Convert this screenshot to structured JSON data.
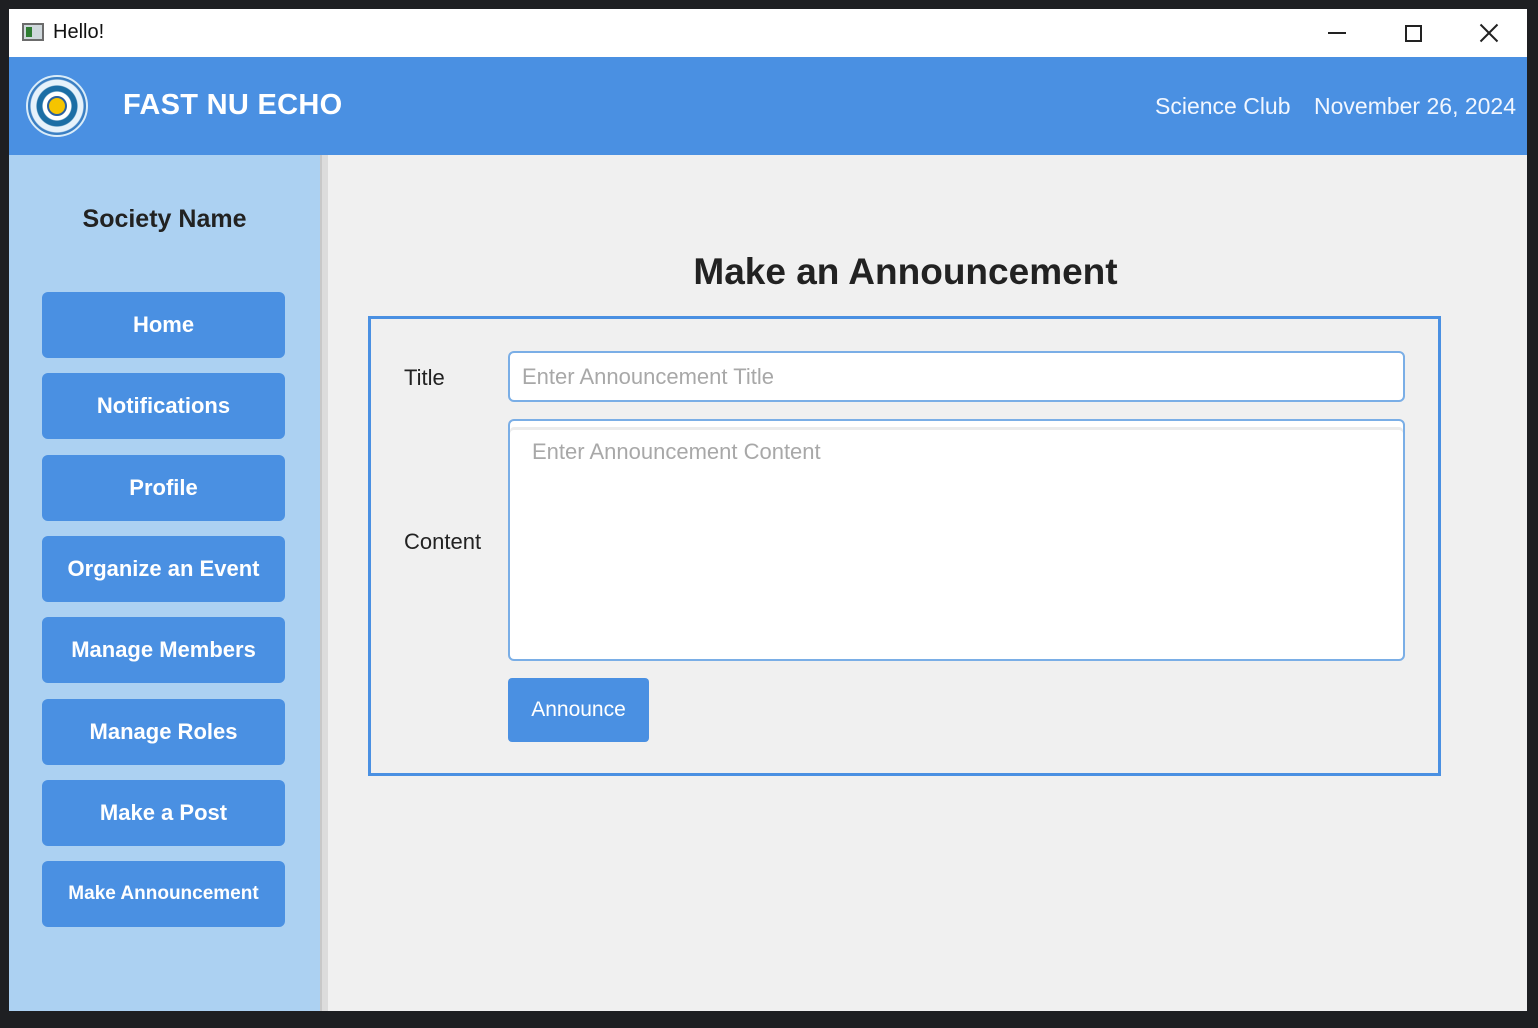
{
  "window": {
    "title": "Hello!"
  },
  "header": {
    "brand": "FAST NU ECHO",
    "society": "Science Club",
    "date": "November 26, 2024"
  },
  "sidebar": {
    "heading": "Society Name",
    "items": [
      {
        "label": "Home"
      },
      {
        "label": "Notifications"
      },
      {
        "label": "Profile"
      },
      {
        "label": "Organize an Event"
      },
      {
        "label": "Manage Members"
      },
      {
        "label": "Manage Roles"
      },
      {
        "label": "Make a Post"
      },
      {
        "label": "Make Announcement"
      }
    ]
  },
  "main": {
    "page_title": "Make an Announcement",
    "form": {
      "title_label": "Title",
      "title_placeholder": "Enter Announcement Title",
      "title_value": "",
      "content_label": "Content",
      "content_placeholder": "Enter Announcement Content",
      "content_value": "",
      "submit_label": "Announce"
    }
  },
  "colors": {
    "accent": "#4a90e2",
    "sidebar_bg": "#acd1f2",
    "content_bg": "#f0f0f0"
  },
  "icons": [
    "app-icon",
    "minimize-icon",
    "maximize-icon",
    "close-icon",
    "logo"
  ]
}
